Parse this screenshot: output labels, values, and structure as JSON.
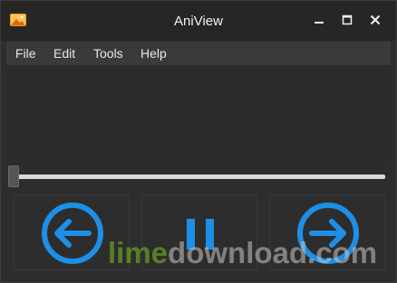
{
  "window": {
    "title": "AniView"
  },
  "menu": {
    "items": [
      "File",
      "Edit",
      "Tools",
      "Help"
    ]
  },
  "slider": {
    "position_fraction": 0.0
  },
  "controls": {
    "previous": "arrow-left-circle-icon",
    "pause": "pause-icon",
    "next": "arrow-right-circle-icon",
    "accent_color": "#1e8fe6"
  },
  "watermark": {
    "lime": "lime",
    "rest": "download.com"
  }
}
